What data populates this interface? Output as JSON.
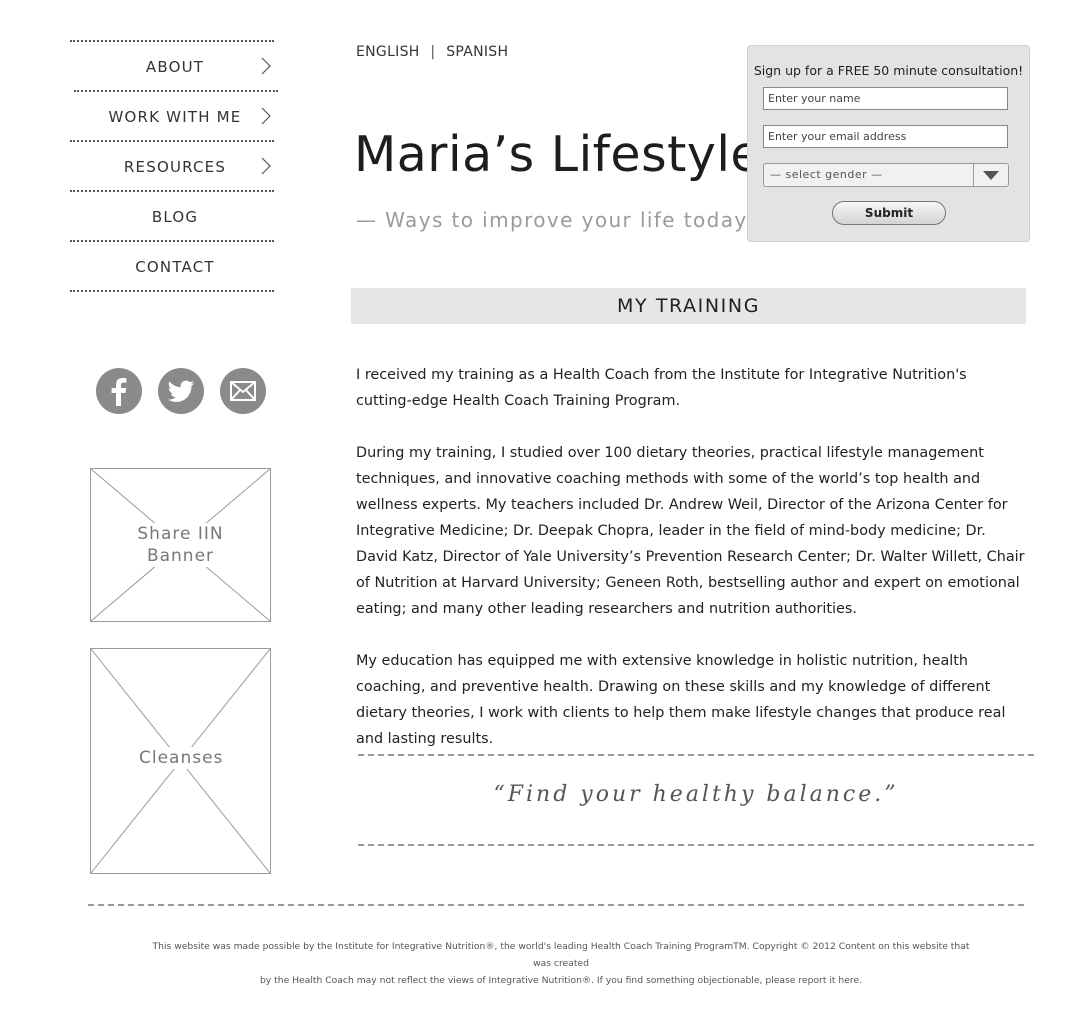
{
  "nav": {
    "items": [
      {
        "label": "ABOUT",
        "has_submenu": true
      },
      {
        "label": "WORK WITH ME",
        "has_submenu": true
      },
      {
        "label": "RESOURCES",
        "has_submenu": true
      },
      {
        "label": "BLOG",
        "has_submenu": false
      },
      {
        "label": "CONTACT",
        "has_submenu": false
      }
    ]
  },
  "social": [
    "facebook-icon",
    "twitter-icon",
    "email-icon"
  ],
  "placeholders": {
    "banner_label": "Share IIN Banner",
    "cleanses_label": "Cleanses"
  },
  "header": {
    "lang_english": "ENGLISH",
    "lang_separator": "|",
    "lang_spanish": "SPANISH",
    "title": "Maria’s Lifestyle",
    "tagline": "— Ways to improve your life today —"
  },
  "signup": {
    "heading": "Sign up for a FREE 50 minute consultation!",
    "name_placeholder": "Enter your name",
    "email_placeholder": "Enter your email address",
    "gender_selected": "—  select gender  —",
    "submit_label": "Submit"
  },
  "main": {
    "section_title": "MY TRAINING",
    "paragraphs": [
      "I received my training as a Health Coach from the Institute for Integrative Nutrition's cutting-edge Health Coach Training Program.",
      "During my training, I studied over 100 dietary theories, practical lifestyle management techniques, and innovative coaching methods with some of the world’s top health and wellness experts. My teachers included Dr. Andrew Weil, Director of the Arizona Center for Integrative Medicine; Dr. Deepak Chopra, leader in the field of mind-body medicine; Dr. David Katz, Director of Yale University’s Prevention Research Center; Dr. Walter Willett, Chair of Nutrition at Harvard University; Geneen Roth, bestselling author and expert on emotional eating; and many other leading researchers and nutrition authorities.",
      "My education has equipped me with extensive knowledge in holistic nutrition, health coaching, and preventive health. Drawing on these skills and my knowledge of different dietary theories, I work with clients to help them make lifestyle changes that produce real and lasting results."
    ],
    "quote": "“Find your healthy balance.”"
  },
  "footer": {
    "line1": "This website was made possible by the Institute for Integrative Nutrition®, the world's leading Health Coach Training ProgramTM. Copyright © 2012 Content on this website that was created",
    "line2": "by the Health Coach may not reflect the views of Integrative Nutrition®. If you find something objectionable, please report it here."
  },
  "colors": {
    "accent_gray": "#8a8a8a",
    "section_bar": "#e6e6e6",
    "signup_bg": "#e3e3e3"
  }
}
